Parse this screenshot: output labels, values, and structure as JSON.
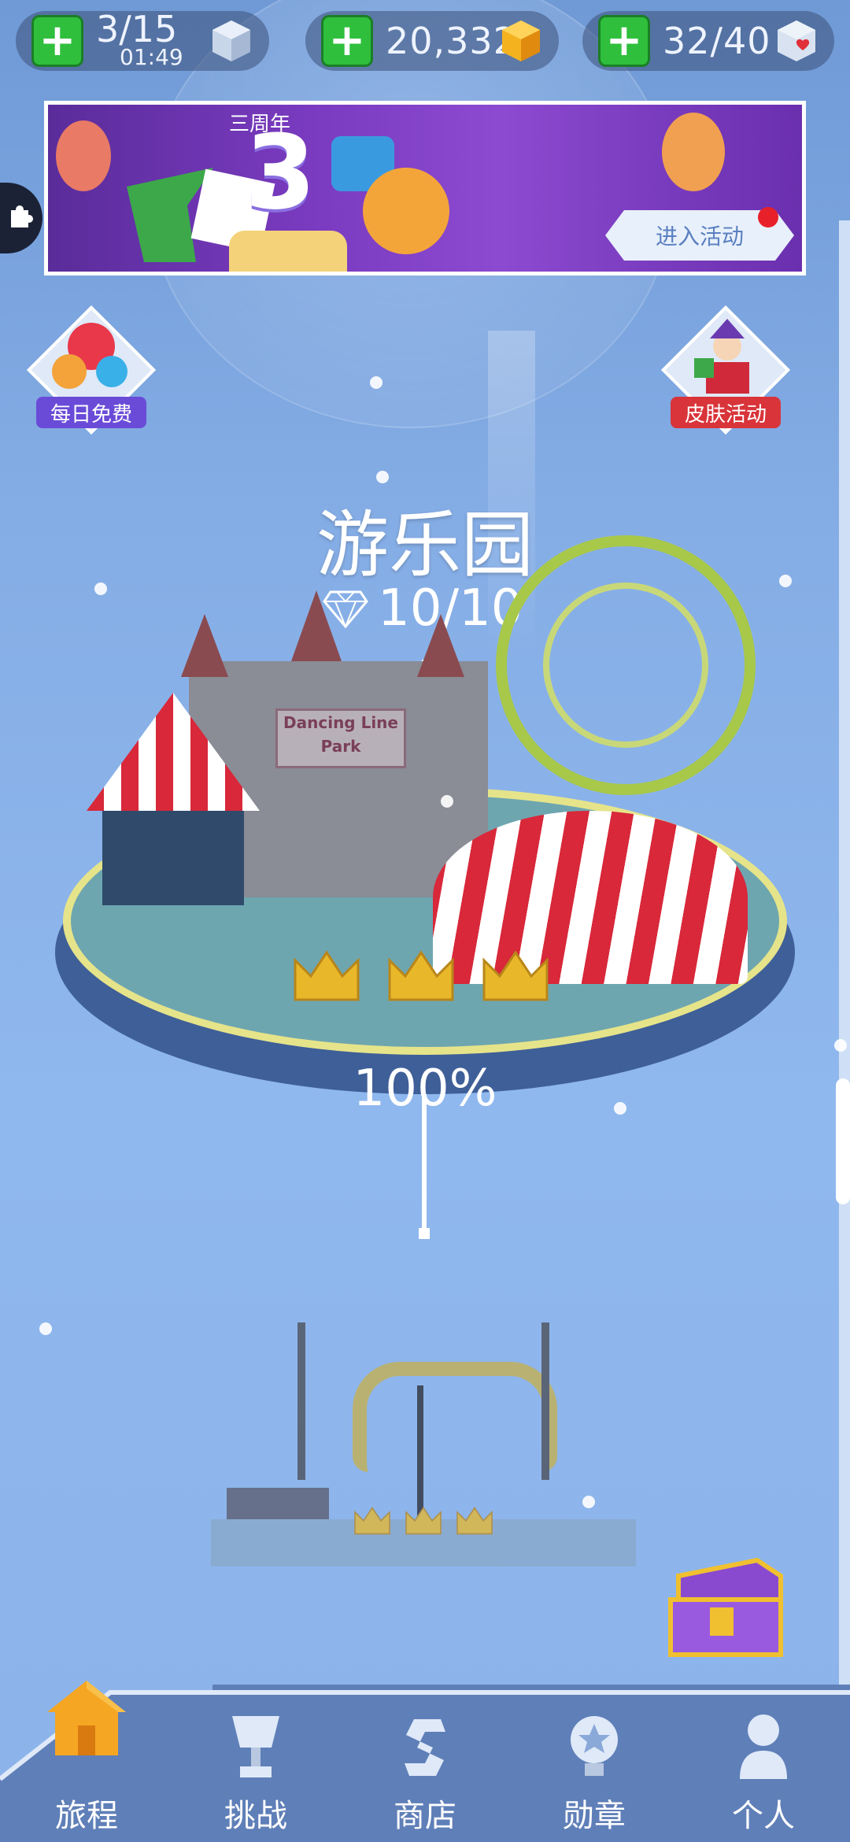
{
  "resources": {
    "lives": {
      "value": "3/15",
      "timer": "01:49"
    },
    "coins": {
      "value": "20,332"
    },
    "hearts": {
      "value": "32/40"
    }
  },
  "banner": {
    "tag": "三周年",
    "anniversary_number": "3",
    "enter_label": "进入活动"
  },
  "side_buttons": {
    "daily_free": "每日免费",
    "skin_event": "皮肤活动"
  },
  "level": {
    "title": "游乐园",
    "gems": "10/10",
    "sign_text_line1": "Dancing Line",
    "sign_text_line2": "Park",
    "progress": "100%",
    "progress_fraction": 1.0
  },
  "nav": {
    "items": [
      {
        "label": "旅程",
        "icon": "house-icon"
      },
      {
        "label": "挑战",
        "icon": "trophy-icon"
      },
      {
        "label": "商店",
        "icon": "shop-s-icon"
      },
      {
        "label": "勋章",
        "icon": "medal-icon"
      },
      {
        "label": "个人",
        "icon": "person-icon"
      }
    ]
  },
  "colors": {
    "green_plus": "#2fbf3c",
    "banner_purple": "#7a3bc0",
    "daily_label": "#6a4bd8",
    "skin_label": "#d8343a",
    "nav_bg": "#5f7fb8",
    "home_orange": "#f5a623"
  }
}
